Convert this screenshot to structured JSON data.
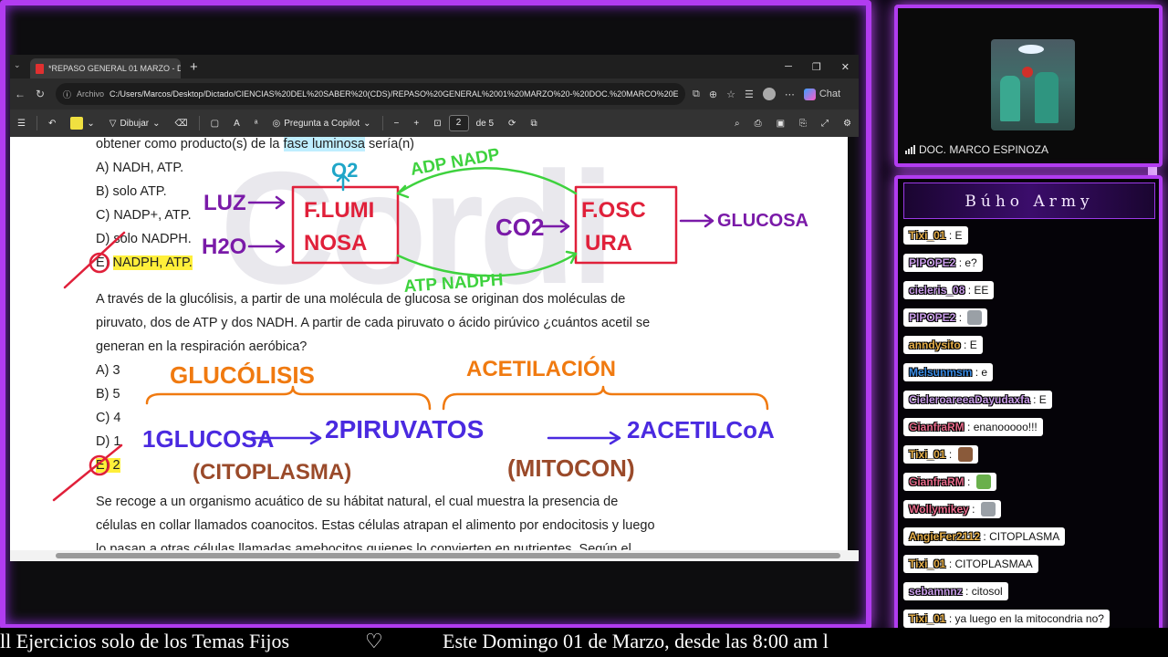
{
  "browser": {
    "tab_title": "*REPASO GENERAL 01 MARZO - D",
    "tab_close": "✕",
    "new_tab": "+",
    "url_label": "Archivo",
    "url": "C:/Users/Marcos/Desktop/Dictado/CIENCIAS%20DEL%20SABER%20(CDS)/REPASO%20GENERAL%2001%20MARZO%20-%20DOC.%20MARCO%20ES...",
    "chat_label": "Chat"
  },
  "pdf_toolbar": {
    "draw_label": "Dibujar",
    "copilot_label": "Pregunta a Copilot",
    "page_current": "2",
    "page_total": "de 5"
  },
  "document": {
    "q1_tail_pre": "obtener como producto(s) de la ",
    "q1_tail_hl": "fase luminosa",
    "q1_tail_post": " sería(n)",
    "q1_options": [
      "A) NADH, ATP.",
      "B) solo ATP.",
      "C) NADP+, ATP.",
      "D) solo NADPH."
    ],
    "q1_opt_e_letter": "E)",
    "q1_opt_e_text": "NADPH, ATP.",
    "q2_lines": [
      "A través de la glucólisis, a partir de una molécula de glucosa se originan dos moléculas de",
      "piruvato, dos de ATP y dos NADH. A partir de cada piruvato o ácido pirúvico ¿cuántos acetil se",
      "generan en la respiración aeróbica?"
    ],
    "q2_options": [
      "A) 3",
      "B) 5",
      "C) 4",
      "D) 1"
    ],
    "q2_opt_e": "E) 2",
    "q3_lines": [
      "Se recoge a un organismo acuático de su hábitat natural, el cual muestra la presencia de",
      "células en collar llamados coanocitos. Estas células atrapan el alimento por endocitosis y luego",
      "lo pasan a otras células llamadas amebocitos quienes lo convierten en nutrientes. Según el"
    ],
    "watermark": "Cordi"
  },
  "handwriting": {
    "o2": "O2",
    "adp_nadp": "ADP NADP",
    "luz": "LUZ",
    "h2o": "H2O",
    "f_lumi": "F.LUMI",
    "nosa": "NOSA",
    "co2": "CO2",
    "f_osc": "F.OSC",
    "ura": "URA",
    "glucosa_right": "GLUCOSA",
    "atp_nadph": "ATP NADPH",
    "glucolisis": "GLUCÓLISIS",
    "acetilacion": "ACETILACIÓN",
    "glucosa": "1GLUCOSA",
    "dos_piruvatos": "2PIRUVATOS",
    "dos_acetil": "2ACETILCoA",
    "citoplasma": "(CITOPLASMA)",
    "mitocondria": "(MITOCON)"
  },
  "camera": {
    "name": "DOC. MARCO ESPINOZA"
  },
  "chat": {
    "title": "Búho Army",
    "messages": [
      {
        "user": "Tixi_01",
        "text": "E",
        "color": "#e8b04a",
        "emote": ""
      },
      {
        "user": "PIPOPE2",
        "text": "e?",
        "color": "#c89be8",
        "emote": ""
      },
      {
        "user": "cieleris_08",
        "text": "EE",
        "color": "#c89be8",
        "emote": ""
      },
      {
        "user": "PIPOPE2",
        "text": "",
        "color": "#c89be8",
        "emote": "cat"
      },
      {
        "user": "anndysito",
        "text": "E",
        "color": "#e8b04a",
        "emote": ""
      },
      {
        "user": "Melsunmsm",
        "text": "e",
        "color": "#3a8ee8",
        "emote": ""
      },
      {
        "user": "CieleroareeaDayudaxfa",
        "text": "E",
        "color": "#c89be8",
        "emote": ""
      },
      {
        "user": "GianfraRM",
        "text": "enanooooo!!!",
        "color": "#e86a8a",
        "emote": ""
      },
      {
        "user": "Tixi_01",
        "text": "",
        "color": "#e8b04a",
        "emote": "dog"
      },
      {
        "user": "GianfraRM",
        "text": "",
        "color": "#e86a8a",
        "emote": "pepe"
      },
      {
        "user": "Wollymikey",
        "text": "",
        "color": "#e86a8a",
        "emote": "cat"
      },
      {
        "user": "AngieFer2112",
        "text": "CITOPLASMA",
        "color": "#e8b04a",
        "emote": ""
      },
      {
        "user": "Tixi_01",
        "text": "CITOPLASMAA",
        "color": "#e8b04a",
        "emote": ""
      },
      {
        "user": "sebamnnz",
        "text": "citosol",
        "color": "#c89be8",
        "emote": ""
      },
      {
        "user": "Tixi_01",
        "text": "ya luego en la mitocondria no?",
        "color": "#e8b04a",
        "emote": ""
      }
    ]
  },
  "ticker": {
    "left": "ll Ejercicios solo de los Temas Fijos",
    "heart": "♡",
    "right": "Este Domingo 01 de Marzo, desde las 8:00 am l"
  },
  "colors": {
    "frame": "#b13cf0",
    "ink_red": "#e0203a",
    "ink_purple": "#7a1aa8",
    "ink_green": "#3ed23e",
    "ink_orange": "#f07a10",
    "ink_blue": "#4a2ae0",
    "ink_brown": "#9a4a2a",
    "ink_teal": "#20a6c8"
  }
}
